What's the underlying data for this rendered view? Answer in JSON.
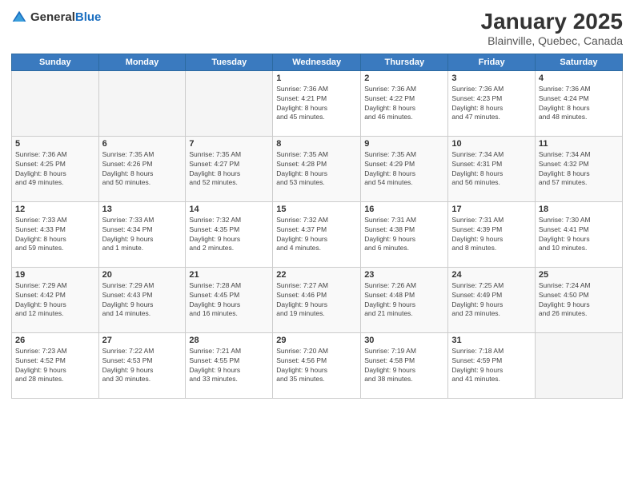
{
  "header": {
    "logo_general": "General",
    "logo_blue": "Blue",
    "title": "January 2025",
    "subtitle": "Blainville, Quebec, Canada"
  },
  "days_of_week": [
    "Sunday",
    "Monday",
    "Tuesday",
    "Wednesday",
    "Thursday",
    "Friday",
    "Saturday"
  ],
  "weeks": [
    [
      {
        "day": "",
        "info": ""
      },
      {
        "day": "",
        "info": ""
      },
      {
        "day": "",
        "info": ""
      },
      {
        "day": "1",
        "info": "Sunrise: 7:36 AM\nSunset: 4:21 PM\nDaylight: 8 hours\nand 45 minutes."
      },
      {
        "day": "2",
        "info": "Sunrise: 7:36 AM\nSunset: 4:22 PM\nDaylight: 8 hours\nand 46 minutes."
      },
      {
        "day": "3",
        "info": "Sunrise: 7:36 AM\nSunset: 4:23 PM\nDaylight: 8 hours\nand 47 minutes."
      },
      {
        "day": "4",
        "info": "Sunrise: 7:36 AM\nSunset: 4:24 PM\nDaylight: 8 hours\nand 48 minutes."
      }
    ],
    [
      {
        "day": "5",
        "info": "Sunrise: 7:36 AM\nSunset: 4:25 PM\nDaylight: 8 hours\nand 49 minutes."
      },
      {
        "day": "6",
        "info": "Sunrise: 7:35 AM\nSunset: 4:26 PM\nDaylight: 8 hours\nand 50 minutes."
      },
      {
        "day": "7",
        "info": "Sunrise: 7:35 AM\nSunset: 4:27 PM\nDaylight: 8 hours\nand 52 minutes."
      },
      {
        "day": "8",
        "info": "Sunrise: 7:35 AM\nSunset: 4:28 PM\nDaylight: 8 hours\nand 53 minutes."
      },
      {
        "day": "9",
        "info": "Sunrise: 7:35 AM\nSunset: 4:29 PM\nDaylight: 8 hours\nand 54 minutes."
      },
      {
        "day": "10",
        "info": "Sunrise: 7:34 AM\nSunset: 4:31 PM\nDaylight: 8 hours\nand 56 minutes."
      },
      {
        "day": "11",
        "info": "Sunrise: 7:34 AM\nSunset: 4:32 PM\nDaylight: 8 hours\nand 57 minutes."
      }
    ],
    [
      {
        "day": "12",
        "info": "Sunrise: 7:33 AM\nSunset: 4:33 PM\nDaylight: 8 hours\nand 59 minutes."
      },
      {
        "day": "13",
        "info": "Sunrise: 7:33 AM\nSunset: 4:34 PM\nDaylight: 9 hours\nand 1 minute."
      },
      {
        "day": "14",
        "info": "Sunrise: 7:32 AM\nSunset: 4:35 PM\nDaylight: 9 hours\nand 2 minutes."
      },
      {
        "day": "15",
        "info": "Sunrise: 7:32 AM\nSunset: 4:37 PM\nDaylight: 9 hours\nand 4 minutes."
      },
      {
        "day": "16",
        "info": "Sunrise: 7:31 AM\nSunset: 4:38 PM\nDaylight: 9 hours\nand 6 minutes."
      },
      {
        "day": "17",
        "info": "Sunrise: 7:31 AM\nSunset: 4:39 PM\nDaylight: 9 hours\nand 8 minutes."
      },
      {
        "day": "18",
        "info": "Sunrise: 7:30 AM\nSunset: 4:41 PM\nDaylight: 9 hours\nand 10 minutes."
      }
    ],
    [
      {
        "day": "19",
        "info": "Sunrise: 7:29 AM\nSunset: 4:42 PM\nDaylight: 9 hours\nand 12 minutes."
      },
      {
        "day": "20",
        "info": "Sunrise: 7:29 AM\nSunset: 4:43 PM\nDaylight: 9 hours\nand 14 minutes."
      },
      {
        "day": "21",
        "info": "Sunrise: 7:28 AM\nSunset: 4:45 PM\nDaylight: 9 hours\nand 16 minutes."
      },
      {
        "day": "22",
        "info": "Sunrise: 7:27 AM\nSunset: 4:46 PM\nDaylight: 9 hours\nand 19 minutes."
      },
      {
        "day": "23",
        "info": "Sunrise: 7:26 AM\nSunset: 4:48 PM\nDaylight: 9 hours\nand 21 minutes."
      },
      {
        "day": "24",
        "info": "Sunrise: 7:25 AM\nSunset: 4:49 PM\nDaylight: 9 hours\nand 23 minutes."
      },
      {
        "day": "25",
        "info": "Sunrise: 7:24 AM\nSunset: 4:50 PM\nDaylight: 9 hours\nand 26 minutes."
      }
    ],
    [
      {
        "day": "26",
        "info": "Sunrise: 7:23 AM\nSunset: 4:52 PM\nDaylight: 9 hours\nand 28 minutes."
      },
      {
        "day": "27",
        "info": "Sunrise: 7:22 AM\nSunset: 4:53 PM\nDaylight: 9 hours\nand 30 minutes."
      },
      {
        "day": "28",
        "info": "Sunrise: 7:21 AM\nSunset: 4:55 PM\nDaylight: 9 hours\nand 33 minutes."
      },
      {
        "day": "29",
        "info": "Sunrise: 7:20 AM\nSunset: 4:56 PM\nDaylight: 9 hours\nand 35 minutes."
      },
      {
        "day": "30",
        "info": "Sunrise: 7:19 AM\nSunset: 4:58 PM\nDaylight: 9 hours\nand 38 minutes."
      },
      {
        "day": "31",
        "info": "Sunrise: 7:18 AM\nSunset: 4:59 PM\nDaylight: 9 hours\nand 41 minutes."
      },
      {
        "day": "",
        "info": ""
      }
    ]
  ]
}
